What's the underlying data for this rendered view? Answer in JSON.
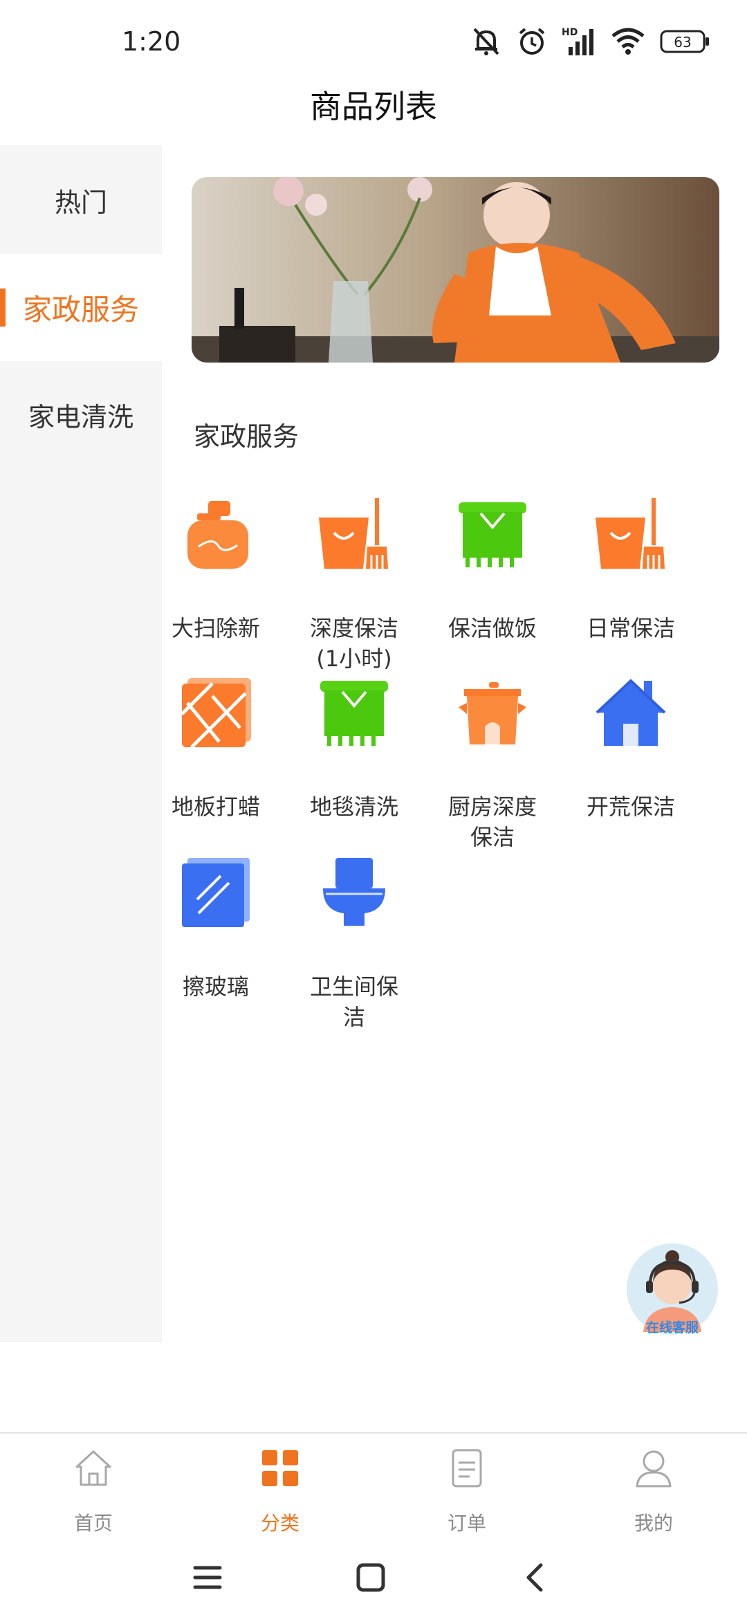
{
  "status_bar": {
    "time": "1:20",
    "battery": "63",
    "network_label": "HD"
  },
  "header": {
    "title": "商品列表"
  },
  "sidebar": {
    "items": [
      {
        "label": "热门",
        "active": false
      },
      {
        "label": "家政服务",
        "active": true
      },
      {
        "label": "家电清洗",
        "active": false
      }
    ]
  },
  "main": {
    "section_title": "家政服务",
    "items": [
      {
        "label": "大扫除新",
        "icon": "lotion-bottle-icon"
      },
      {
        "label": "深度保洁\n(1小时)",
        "icon": "bucket-broom-icon"
      },
      {
        "label": "保洁做饭",
        "icon": "apron-icon"
      },
      {
        "label": "日常保洁",
        "icon": "bucket-broom-icon"
      },
      {
        "label": "地板打蜡",
        "icon": "floor-tiles-icon"
      },
      {
        "label": "地毯清洗",
        "icon": "carpet-icon"
      },
      {
        "label": "厨房深度\n保洁",
        "icon": "cooking-pot-icon"
      },
      {
        "label": "开荒保洁",
        "icon": "house-icon"
      },
      {
        "label": "擦玻璃",
        "icon": "glass-pane-icon"
      },
      {
        "label": "卫生间保\n洁",
        "icon": "toilet-icon"
      }
    ]
  },
  "customer_service": {
    "label": "在线客服"
  },
  "tabbar": {
    "tabs": [
      {
        "label": "首页",
        "icon": "home-icon",
        "active": false
      },
      {
        "label": "分类",
        "icon": "category-grid-icon",
        "active": true
      },
      {
        "label": "订单",
        "icon": "order-document-icon",
        "active": false
      },
      {
        "label": "我的",
        "icon": "user-profile-icon",
        "active": false
      }
    ]
  },
  "colors": {
    "accent": "#f0741f",
    "orange_icon": "#fb7a2c",
    "green_icon": "#58d215",
    "blue_icon": "#3b6ff2"
  }
}
